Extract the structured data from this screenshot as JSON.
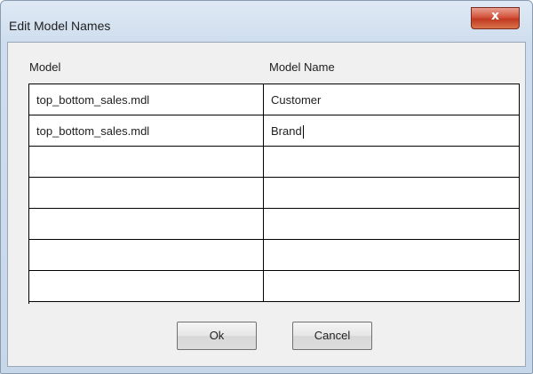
{
  "window": {
    "title": "Edit Model Names",
    "close_label": "x"
  },
  "grid": {
    "headers": {
      "model": "Model",
      "model_name": "Model Name"
    },
    "rows": [
      {
        "model": "top_bottom_sales.mdl",
        "model_name": "Customer"
      },
      {
        "model": "top_bottom_sales.mdl",
        "model_name": "Brand"
      },
      {
        "model": "",
        "model_name": ""
      },
      {
        "model": "",
        "model_name": ""
      },
      {
        "model": "",
        "model_name": ""
      },
      {
        "model": "",
        "model_name": ""
      },
      {
        "model": "",
        "model_name": ""
      }
    ]
  },
  "buttons": {
    "ok": "Ok",
    "cancel": "Cancel"
  }
}
